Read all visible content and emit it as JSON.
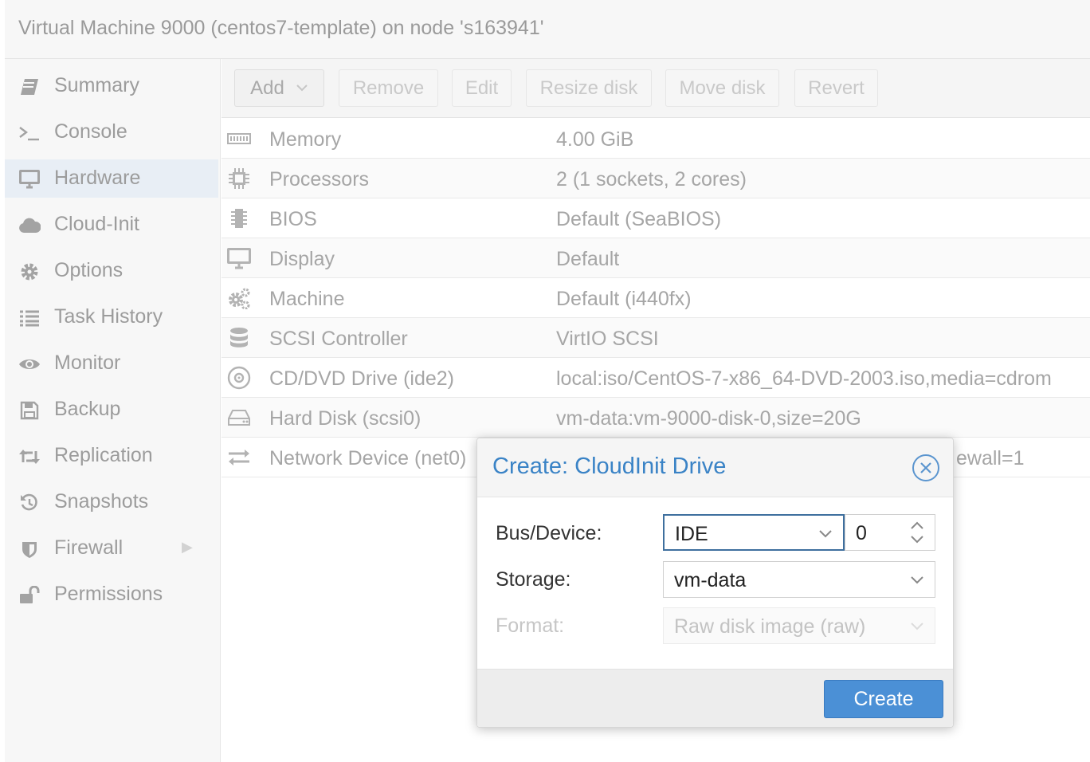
{
  "window": {
    "title": "Virtual Machine 9000 (centos7-template) on node 's163941'"
  },
  "sidebar": {
    "items": [
      {
        "label": "Summary",
        "icon": "book-icon",
        "active": false
      },
      {
        "label": "Console",
        "icon": "terminal-icon",
        "active": false
      },
      {
        "label": "Hardware",
        "icon": "desktop-icon",
        "active": true
      },
      {
        "label": "Cloud-Init",
        "icon": "cloud-icon",
        "active": false
      },
      {
        "label": "Options",
        "icon": "gear-icon",
        "active": false
      },
      {
        "label": "Task History",
        "icon": "list-icon",
        "active": false
      },
      {
        "label": "Monitor",
        "icon": "eye-icon",
        "active": false
      },
      {
        "label": "Backup",
        "icon": "floppy-icon",
        "active": false
      },
      {
        "label": "Replication",
        "icon": "retweet-icon",
        "active": false
      },
      {
        "label": "Snapshots",
        "icon": "history-icon",
        "active": false
      },
      {
        "label": "Firewall",
        "icon": "shield-icon",
        "active": false
      },
      {
        "label": "Permissions",
        "icon": "unlock-icon",
        "active": false
      }
    ]
  },
  "toolbar": {
    "add_label": "Add",
    "remove_label": "Remove",
    "edit_label": "Edit",
    "resize_label": "Resize disk",
    "move_label": "Move disk",
    "revert_label": "Revert"
  },
  "hardware": {
    "rows": [
      {
        "name": "Memory",
        "value": "4.00 GiB",
        "icon": "memory-icon"
      },
      {
        "name": "Processors",
        "value": "2 (1 sockets, 2 cores)",
        "icon": "cpu-icon"
      },
      {
        "name": "BIOS",
        "value": "Default (SeaBIOS)",
        "icon": "microchip-icon"
      },
      {
        "name": "Display",
        "value": "Default",
        "icon": "monitor-icon"
      },
      {
        "name": "Machine",
        "value": "Default (i440fx)",
        "icon": "cogs-icon"
      },
      {
        "name": "SCSI Controller",
        "value": "VirtIO SCSI",
        "icon": "database-icon"
      },
      {
        "name": "CD/DVD Drive (ide2)",
        "value": "local:iso/CentOS-7-x86_64-DVD-2003.iso,media=cdrom",
        "icon": "cdrom-icon"
      },
      {
        "name": "Hard Disk (scsi0)",
        "value": "vm-data:vm-9000-disk-0,size=20G",
        "icon": "hdd-icon"
      },
      {
        "name": "Network Device (net0)",
        "value": "ewall=1",
        "icon": "exchange-icon"
      }
    ]
  },
  "dialog": {
    "title": "Create: CloudInit Drive",
    "bus_label": "Bus/Device:",
    "bus_value": "IDE",
    "device_value": "0",
    "storage_label": "Storage:",
    "storage_value": "vm-data",
    "format_label": "Format:",
    "format_value": "Raw disk image (raw)",
    "create_label": "Create"
  },
  "colors": {
    "accent": "#3a83c6",
    "button_primary": "#4b90d6",
    "active_nav": "#e8eef5"
  }
}
